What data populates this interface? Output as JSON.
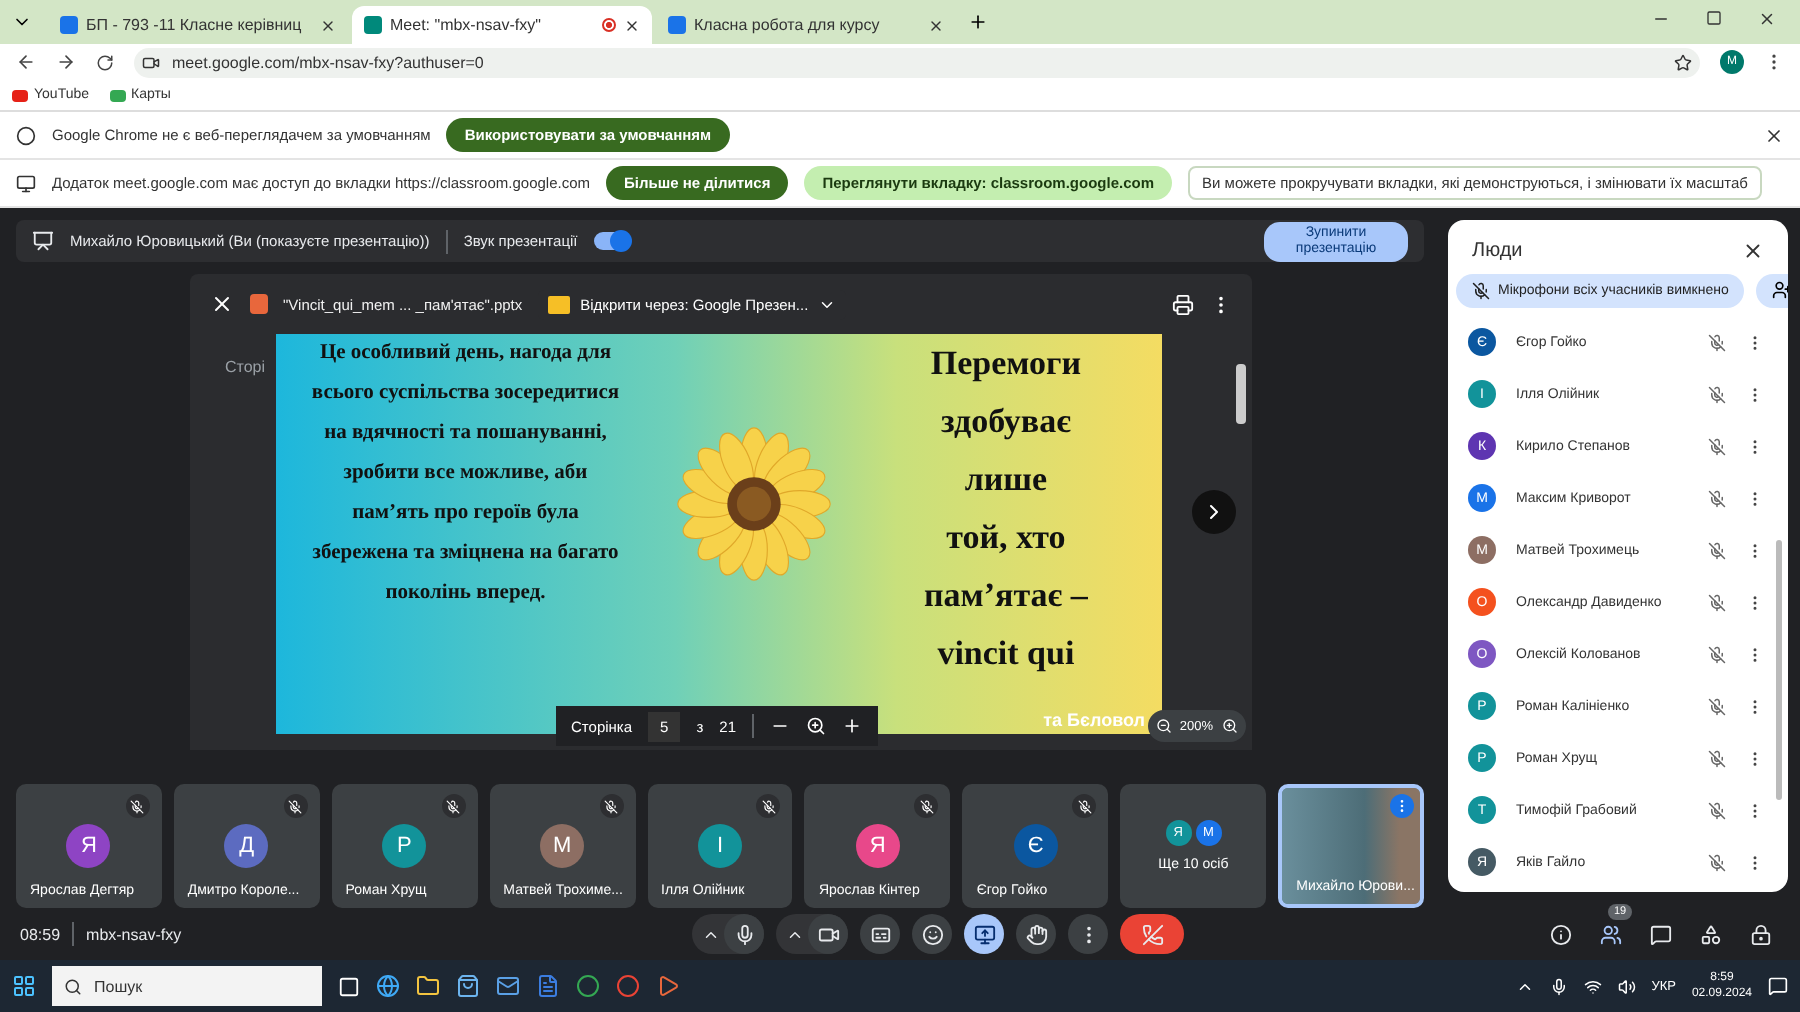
{
  "browser": {
    "tabs": [
      {
        "title": "БП - 793 -11 Класне керівниц",
        "selected": false,
        "recording": false
      },
      {
        "title": "Meet: \"mbx-nsav-fxy\"",
        "selected": true,
        "recording": true
      },
      {
        "title": "Класна робота для курсу",
        "selected": false,
        "recording": false
      }
    ],
    "url": "meet.google.com/mbx-nsav-fxy?authuser=0",
    "profile": "M",
    "bookmarks": [
      "YouTube",
      "Карты"
    ]
  },
  "infobars": [
    {
      "text": "Google Chrome не є веб-переглядачем за умовчанням",
      "buttons": [
        {
          "label": "Використовувати за умовчанням",
          "kind": "primary"
        }
      ]
    },
    {
      "text": "Додаток meet.google.com має доступ до вкладки https://classroom.google.com",
      "buttons": [
        {
          "label": "Більше не ділитися",
          "kind": "primary"
        },
        {
          "label": "Переглянути вкладку: classroom.google.com",
          "kind": "secondary"
        },
        {
          "label": "Ви можете прокручувати вкладки, які демонструються, і змінювати їх масштаб",
          "kind": "note"
        }
      ]
    }
  ],
  "presenting_bar": {
    "text": "Михайло Юровицький (Ви (показуєте презентацію))",
    "audio_label": "Звук презентації",
    "audio_on": true,
    "stop_button": "Зупинити презентацію"
  },
  "viewer": {
    "file_name": "\"Vincit_qui_mem ... _пам'ятає\".pptx",
    "open_with": "Відкрити через: Google Презен...",
    "background_text": "Сторі",
    "slide": {
      "left_text": "Це особливий день, нагода для всього суспільства зосередитися на вдячності та пошануванні, зробити все можливе, аби пам’ять про героїв була збережена та зміцнена на багато поколінь вперед.",
      "right_lines": [
        "Перемоги",
        "здобуває",
        "лише",
        "той, хто",
        "пам’ятає –",
        "vincit qui"
      ],
      "caption": "та Бєловол"
    },
    "page_label": "Сторінка",
    "page": "5",
    "of": "з",
    "total": "21",
    "zoom": "200%"
  },
  "tiles": [
    {
      "kind": "avatar",
      "name": "Ярослав Дегтяр",
      "initial": "Я",
      "color": "#8e44c4",
      "muted": true
    },
    {
      "kind": "avatar",
      "name": "Дмитро Короле...",
      "initial": "Д",
      "color": "#5c6bc0",
      "muted": true
    },
    {
      "kind": "avatar",
      "name": "Роман Хрущ",
      "initial": "Р",
      "color": "#12939a",
      "muted": true
    },
    {
      "kind": "avatar",
      "name": "Матвей Трохиме...",
      "initial": "М",
      "color": "#8d6e63",
      "muted": true
    },
    {
      "kind": "avatar",
      "name": "Ілля Олійник",
      "initial": "І",
      "color": "#12939a",
      "muted": true
    },
    {
      "kind": "avatar",
      "name": "Ярослав Кінтер",
      "initial": "Я",
      "color": "#e8488a",
      "muted": true
    },
    {
      "kind": "avatar",
      "name": "Єгор Гойко",
      "initial": "Є",
      "color": "#0b57a0",
      "muted": true
    },
    {
      "kind": "more",
      "name": "Ще 10 осіб",
      "avatars": [
        {
          "initial": "Я",
          "color": "#12939a"
        },
        {
          "initial": "М",
          "color": "#1a73e8"
        }
      ]
    },
    {
      "kind": "self",
      "name": "Михайло Юрови..."
    }
  ],
  "bottom_bar": {
    "time": "08:59",
    "code": "mbx-nsav-fxy",
    "people_count": "19",
    "controls": [
      {
        "kind": "mic",
        "on": false
      },
      {
        "kind": "camera",
        "on": false
      },
      {
        "kind": "captions",
        "on": false
      },
      {
        "kind": "reactions",
        "on": false
      },
      {
        "kind": "present",
        "on": true
      },
      {
        "kind": "hand",
        "on": false
      },
      {
        "kind": "more",
        "on": false
      },
      {
        "kind": "leave",
        "on": false
      }
    ]
  },
  "people_panel": {
    "title": "Люди",
    "mute_notice": "Мікрофони всіх учасників вимкнено",
    "people": [
      {
        "initial": "Є",
        "name": "Єгор Гойко",
        "color": "#0b57a0",
        "muted": true
      },
      {
        "initial": "І",
        "name": "Ілля Олійник",
        "color": "#12939a",
        "muted": true
      },
      {
        "initial": "К",
        "name": "Кирило Степанов",
        "color": "#5e35b1",
        "muted": true
      },
      {
        "initial": "М",
        "name": "Максим Криворот",
        "color": "#1a73e8",
        "muted": true
      },
      {
        "initial": "М",
        "name": "Матвей Трохимець",
        "color": "#8d6e63",
        "muted": true
      },
      {
        "initial": "О",
        "name": "Олександр Давиденко",
        "color": "#f4511e",
        "muted": true
      },
      {
        "initial": "О",
        "name": "Олексій Колованов",
        "color": "#7e57c2",
        "muted": true
      },
      {
        "initial": "Р",
        "name": "Роман Калініенко",
        "color": "#12939a",
        "muted": true
      },
      {
        "initial": "Р",
        "name": "Роман Хрущ",
        "color": "#12939a",
        "muted": true
      },
      {
        "initial": "Т",
        "name": "Тимофій Грабовий",
        "color": "#12939a",
        "muted": true
      },
      {
        "initial": "Я",
        "name": "Яків Гайло",
        "color": "#455a64",
        "muted": true
      }
    ]
  },
  "taskbar": {
    "search": "Пошук",
    "language": "УКР",
    "time": "8:59",
    "date": "02.09.2024"
  }
}
